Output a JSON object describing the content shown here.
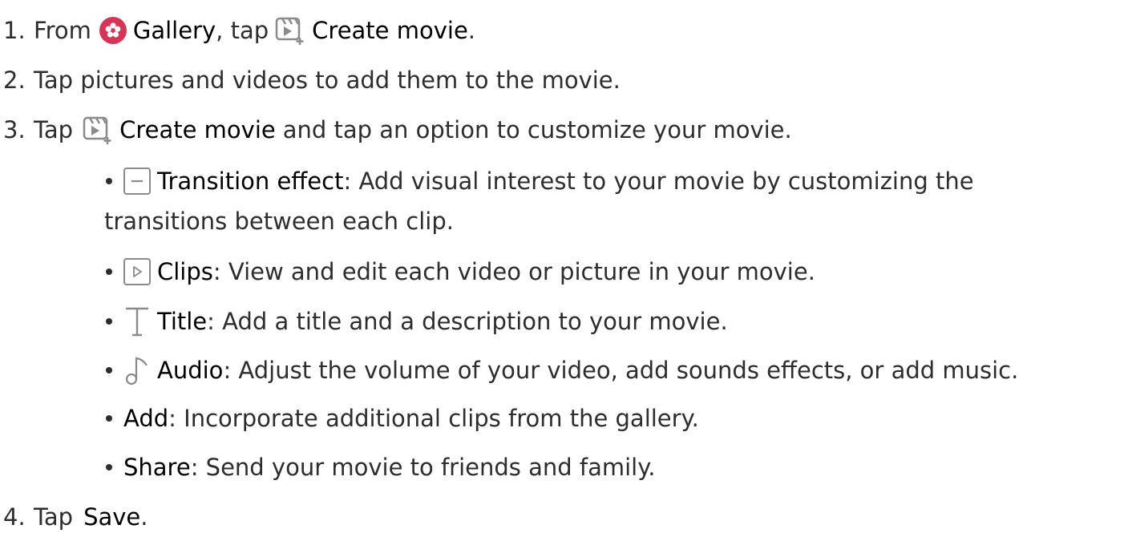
{
  "steps": [
    {
      "number": "1.",
      "pre": "From",
      "gallery_icon": "gallery-flower-icon",
      "gallery_label": "Gallery",
      "mid": ", tap",
      "movie_icon": "create-movie-icon",
      "movie_label": "Create movie",
      "post": "."
    },
    {
      "number": "2.",
      "text": "Tap pictures and videos to add them to the movie."
    },
    {
      "number": "3.",
      "pre": "Tap",
      "movie_icon": "create-movie-icon",
      "movie_label": "Create movie",
      "post": "and tap an option to customize your movie."
    },
    {
      "number": "4.",
      "pre": "Tap",
      "save_label": "Save",
      "post": "."
    }
  ],
  "options": [
    {
      "icon": "transition-effect-icon",
      "label": "Transition effect",
      "desc": ": Add visual interest to your movie by customizing the",
      "desc_cont": "transitions between each clip."
    },
    {
      "icon": "clips-play-icon",
      "label": "Clips",
      "desc": ": View and edit each video or picture in your movie."
    },
    {
      "icon": "title-text-icon",
      "label": "Title",
      "desc": ": Add a title and a description to your movie."
    },
    {
      "icon": "audio-note-icon",
      "label": "Audio",
      "desc": ": Adjust the volume of your video, add sounds effects, or add music."
    },
    {
      "label": "Add",
      "desc": ": Incorporate additional clips from the gallery."
    },
    {
      "label": "Share",
      "desc": ": Send your movie to friends and family."
    }
  ],
  "colors": {
    "text": "#2d2d2d",
    "gallery_icon_bg": "#d63558",
    "icon_gray": "#8a8a8a"
  }
}
